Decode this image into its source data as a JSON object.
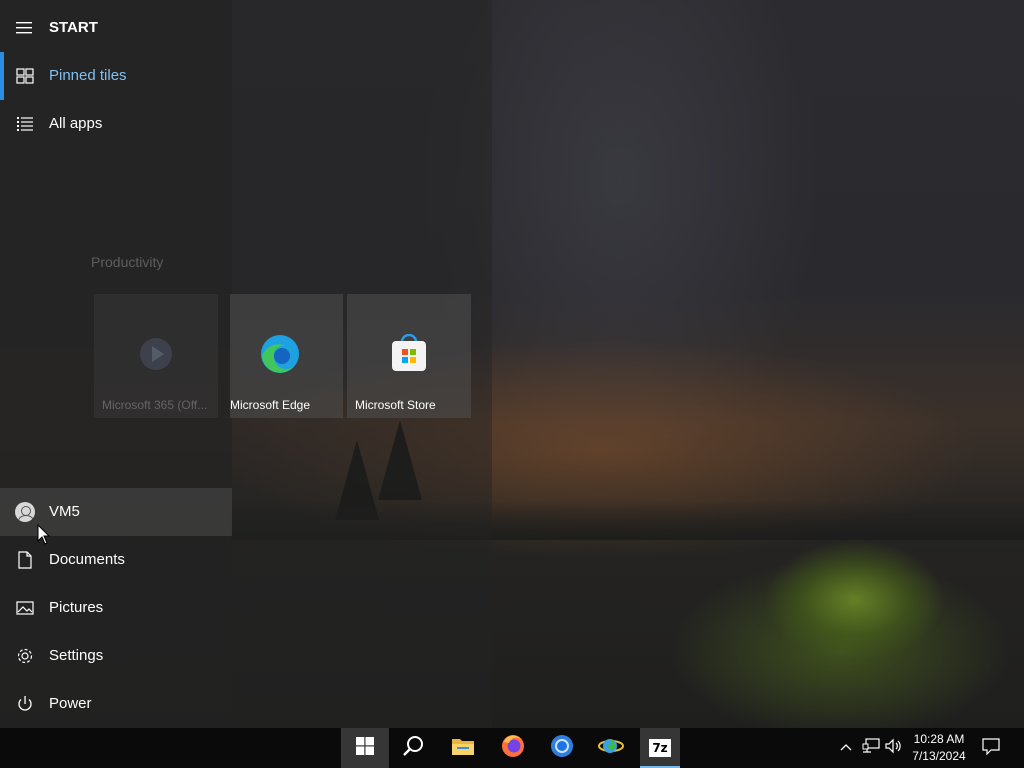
{
  "start": {
    "title": "START",
    "nav": [
      {
        "label": "Pinned tiles",
        "icon": "tiles-icon",
        "active": true
      },
      {
        "label": "All apps",
        "icon": "list-icon"
      }
    ],
    "bottom": [
      {
        "label": "VM5",
        "icon": "user-icon"
      },
      {
        "label": "Documents",
        "icon": "document-icon"
      },
      {
        "label": "Pictures",
        "icon": "pictures-icon"
      },
      {
        "label": "Settings",
        "icon": "gear-icon"
      },
      {
        "label": "Power",
        "icon": "power-icon"
      }
    ]
  },
  "tiles": {
    "group_title": "Productivity",
    "items": [
      {
        "label": "Microsoft 365 (Off...",
        "icon": "microsoft-365-icon",
        "dimmed": true
      },
      {
        "label": "Microsoft Edge",
        "icon": "edge-icon"
      },
      {
        "label": "Microsoft Store",
        "icon": "store-icon"
      }
    ]
  },
  "taskbar": {
    "apps": [
      "windows-start-icon",
      "search-icon",
      "file-explorer-icon",
      "firefox-icon",
      "chrome-icon",
      "ie-download-icon",
      "7zip-icon"
    ],
    "app_7z_label": "7z",
    "time": "10:28 AM",
    "date": "7/13/2024"
  },
  "colors": {
    "accent": "#2d8de2",
    "active_text": "#7fc0f0",
    "taskbar": "#0a0a0a"
  }
}
